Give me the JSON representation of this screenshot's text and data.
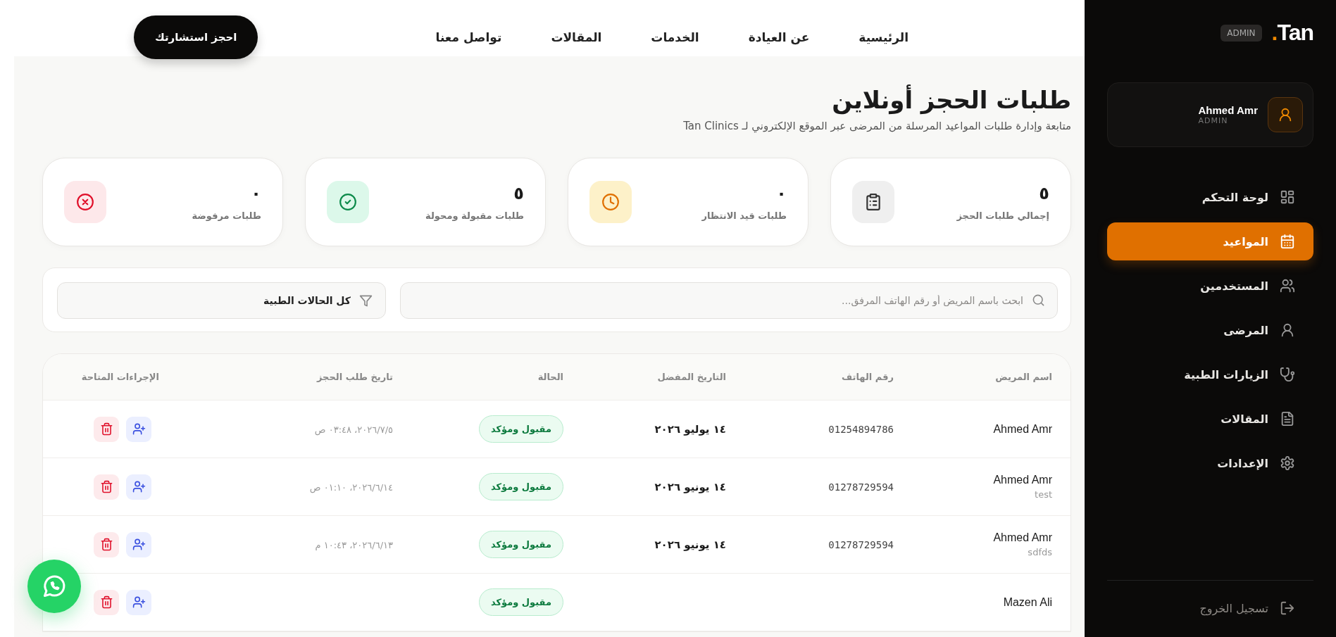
{
  "sidebar": {
    "logo": "Tan",
    "logo_dot": ".",
    "badge": "ADMIN",
    "profile": {
      "name": "Ahmed Amr",
      "role": "ADMIN"
    },
    "items": [
      {
        "kind": "dashboard",
        "label": "لوحة التحكم",
        "selected": false
      },
      {
        "kind": "calendar",
        "label": "المواعيد",
        "selected": true
      },
      {
        "kind": "users",
        "label": "المستخدمين",
        "selected": false
      },
      {
        "kind": "user",
        "label": "المرضى",
        "selected": false
      },
      {
        "kind": "stethoscope",
        "label": "الزيارات الطبية",
        "selected": false
      },
      {
        "kind": "document",
        "label": "المقالات",
        "selected": false
      },
      {
        "kind": "settings",
        "label": "الإعدادات",
        "selected": false
      }
    ],
    "logout": "تسجيل الخروج"
  },
  "top_nav": {
    "links": [
      "الرئيسية",
      "عن العيادة",
      "الخدمات",
      "المقالات",
      "تواصل معنا"
    ],
    "cta": "احجز استشارتك"
  },
  "page": {
    "title": "طلبات الحجز أونلاين",
    "subtitle": "متابعة وإدارة طلبات المواعيد المرسلة من المرضى عبر الموقع الإلكتروني لـ Tan Clinics"
  },
  "stats": [
    {
      "kind": "total",
      "value": "٥",
      "label": "إجمالي طلبات الحجز"
    },
    {
      "kind": "pending",
      "value": "٠",
      "label": "طلبات قيد الانتظار"
    },
    {
      "kind": "accepted",
      "value": "٥",
      "label": "طلبات مقبولة ومحولة"
    },
    {
      "kind": "rejected",
      "value": "٠",
      "label": "طلبات مرفوضة"
    }
  ],
  "filters": {
    "search_placeholder": "ابحث باسم المريض أو رقم الهاتف المرفق...",
    "status_filter": "كل الحالات الطبية"
  },
  "table": {
    "columns": [
      "اسم المريض",
      "رقم الهاتف",
      "التاريخ المفضل",
      "الحالة",
      "تاريخ طلب الحجز",
      "الإجراءات المتاحة"
    ],
    "rows": [
      {
        "name": "Ahmed Amr",
        "phone": "01254894786",
        "preferred_date": "١٤ يوليو ٢٠٢٦",
        "status": {
          "kind": "accepted",
          "label": "مقبول ومؤكد"
        },
        "requested_at": "‏٥‏/٧‏/٢٠٢٦، ٠٣:٤٨ ص"
      },
      {
        "name": "Ahmed Amr",
        "note": "test",
        "phone": "01278729594",
        "preferred_date": "١٤ يونيو ٢٠٢٦",
        "status": {
          "kind": "accepted",
          "label": "مقبول ومؤكد"
        },
        "requested_at": "‏١٤‏/٦‏/٢٠٢٦، ٠١:١٠ ص"
      },
      {
        "name": "Ahmed Amr",
        "note": "sdfds",
        "phone": "01278729594",
        "preferred_date": "١٤ يونيو ٢٠٢٦",
        "status": {
          "kind": "accepted",
          "label": "مقبول ومؤكد"
        },
        "requested_at": "‏١٣‏/٦‏/٢٠٢٦، ١٠:٤٣ م"
      },
      {
        "name": "Mazen Ali",
        "status": {
          "kind": "accepted",
          "label": "مقبول ومؤكد"
        }
      }
    ]
  }
}
